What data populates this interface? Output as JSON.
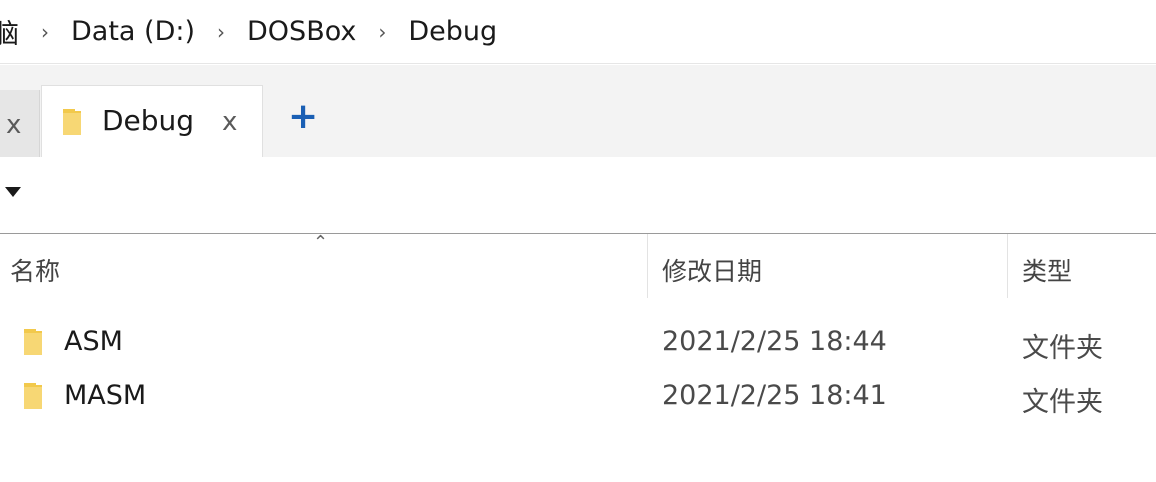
{
  "breadcrumb": {
    "items": [
      "脑",
      "Data (D:)",
      "DOSBox",
      "Debug"
    ]
  },
  "tabs": {
    "prev_close": "x",
    "active_label": "Debug",
    "active_close": "x",
    "new_tab": "+"
  },
  "columns": {
    "name": "名称",
    "modified": "修改日期",
    "type": "类型"
  },
  "files": [
    {
      "name": "ASM",
      "modified": "2021/2/25 18:44",
      "type": "文件夹",
      "icon": "folder-icon"
    },
    {
      "name": "MASM",
      "modified": "2021/2/25 18:41",
      "type": "文件夹",
      "icon": "folder-icon"
    }
  ],
  "colors": {
    "folder": "#f2c94c",
    "accent": "#1a5fb4"
  }
}
